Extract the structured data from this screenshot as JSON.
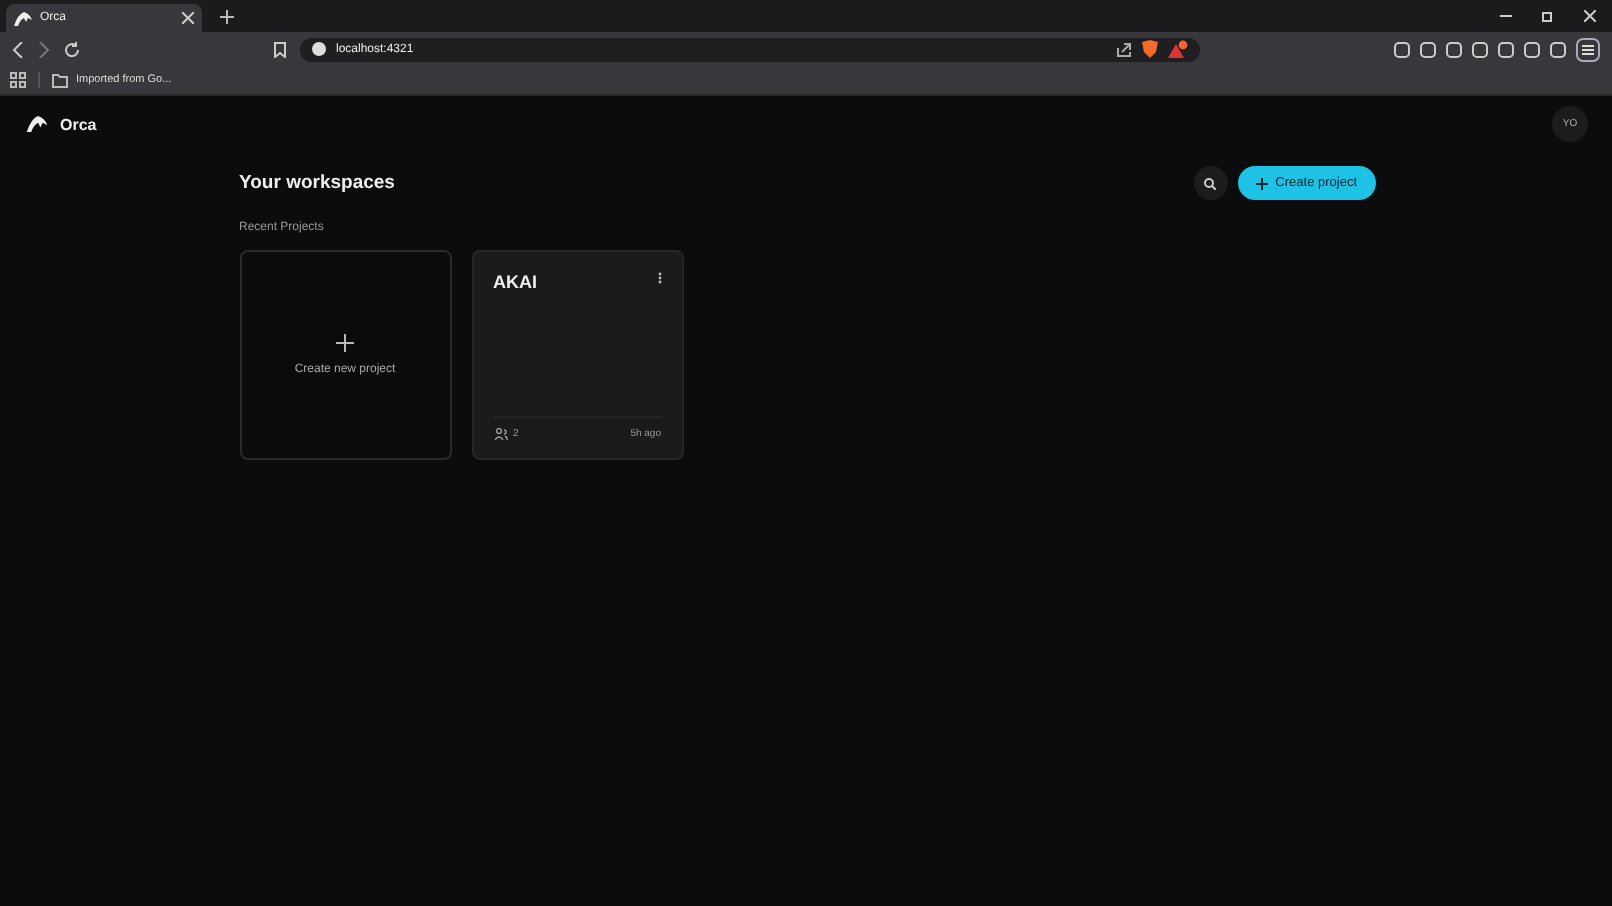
{
  "browser": {
    "tabs": [
      {
        "title": "Orca",
        "selected": true
      }
    ],
    "address": "localhost:4321",
    "bookmarks": [
      {
        "label": "Imported from Go..."
      }
    ]
  },
  "app": {
    "brand": "Orca",
    "avatar": "YO"
  },
  "workspaces": {
    "title": "Your workspaces",
    "create_button": "Create project",
    "section": "Recent Projects",
    "new_project": "Create new project",
    "projects": [
      {
        "name": "AKAI",
        "members": "2",
        "updated": "5h ago"
      }
    ]
  }
}
